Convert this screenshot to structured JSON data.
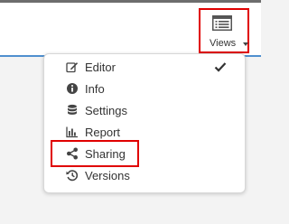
{
  "toolbar": {
    "views_label": "Views",
    "views_icon": "views-list-icon"
  },
  "menu": {
    "items": [
      {
        "label": "Editor",
        "icon": "edit-icon",
        "checked": true
      },
      {
        "label": "Info",
        "icon": "info-icon"
      },
      {
        "label": "Settings",
        "icon": "database-icon"
      },
      {
        "label": "Report",
        "icon": "bar-chart-icon"
      },
      {
        "label": "Sharing",
        "icon": "share-icon",
        "highlighted": true
      },
      {
        "label": "Versions",
        "icon": "history-icon"
      }
    ]
  },
  "colors": {
    "highlight": "#e00000",
    "accent_line": "#4f8fce",
    "text": "#333333"
  }
}
